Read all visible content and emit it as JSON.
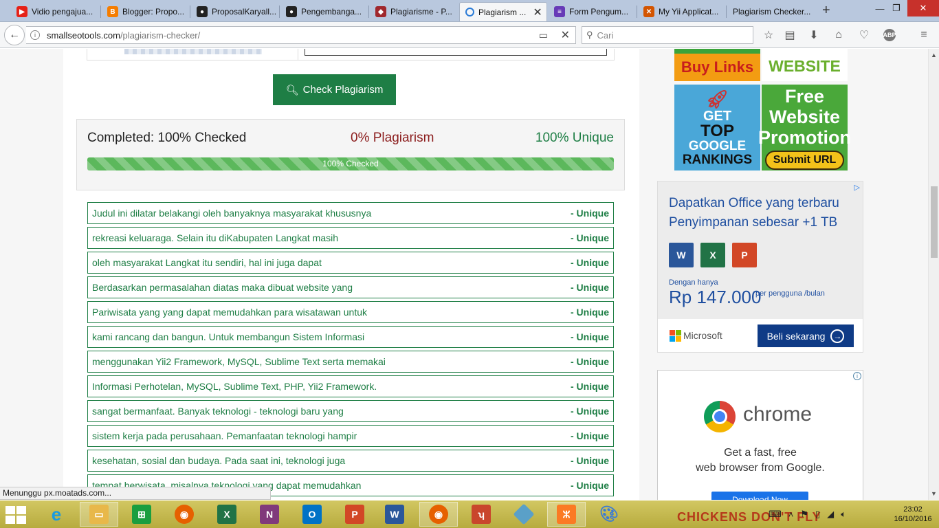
{
  "browser": {
    "tabs": [
      {
        "label": "Vidio pengajua...",
        "favicon": "youtube-icon",
        "color": "#e62117"
      },
      {
        "label": "Blogger: Propo...",
        "favicon": "blogger-icon",
        "color": "#f57d00"
      },
      {
        "label": "ProposalKaryall...",
        "favicon": "github-icon",
        "color": "#222222"
      },
      {
        "label": "Pengembanga...",
        "favicon": "github-icon",
        "color": "#222222"
      },
      {
        "label": "Plagiarisme - P...",
        "favicon": "site-icon",
        "color": "#a0282d"
      },
      {
        "label": "Plagiarism ...",
        "favicon": "loading-icon",
        "color": "#2b7bd6",
        "active": true
      },
      {
        "label": "Form Pengum...",
        "favicon": "forms-icon",
        "color": "#673ab7"
      },
      {
        "label": "My Yii Applicat...",
        "favicon": "yii-icon",
        "color": "#d35400"
      },
      {
        "label": "Plagiarism Checker...",
        "favicon": "",
        "color": ""
      }
    ],
    "url_host": "smallseotools.com",
    "url_path": "/plagiarism-checker/",
    "search_placeholder": "Cari",
    "status_text": "Menunggu px.moatads.com..."
  },
  "checker": {
    "button_label": "Check Plagiarism",
    "completed_label": "Completed: 100% Checked",
    "plagiarism_label": "0% Plagiarism",
    "unique_label": "100% Unique",
    "progress_label": "100% Checked",
    "progress_value": 1.0,
    "results": [
      {
        "text": "Judul ini dilatar belakangi oleh banyaknya masyarakat khususnya",
        "tag": "- Unique"
      },
      {
        "text": "rekreasi keluaraga. Selain itu diKabupaten Langkat masih",
        "tag": "- Unique"
      },
      {
        "text": "oleh masyarakat Langkat itu sendiri, hal ini juga dapat",
        "tag": "- Unique"
      },
      {
        "text": "Berdasarkan permasalahan diatas maka dibuat website yang",
        "tag": "- Unique"
      },
      {
        "text": "Pariwisata yang yang dapat memudahkan para wisatawan untuk",
        "tag": "- Unique"
      },
      {
        "text": "kami rancang dan bangun. Untuk membangun Sistem Informasi",
        "tag": "- Unique"
      },
      {
        "text": "menggunakan Yii2 Framework, MySQL, Sublime Text serta memakai",
        "tag": "- Unique"
      },
      {
        "text": "Informasi Perhotelan, MySQL, Sublime Text, PHP, Yii2 Framework.",
        "tag": "- Unique"
      },
      {
        "text": "sangat bermanfaat. Banyak teknologi - teknologi baru yang",
        "tag": "- Unique"
      },
      {
        "text": "sistem kerja pada perusahaan. Pemanfaatan teknologi hampir",
        "tag": "- Unique"
      },
      {
        "text": "kesehatan, sosial dan budaya. Pada saat ini, teknologi juga",
        "tag": "- Unique"
      },
      {
        "text": "tempat berwisata, misalnya teknologi yang dapat memudahkan",
        "tag": "- Unique"
      }
    ]
  },
  "sidebar": {
    "ad_buylinks": "Buy Links",
    "ad_website": "WEBSITE",
    "ad_rankings": [
      "GET",
      "TOP",
      "GOOGLE",
      "RANKINGS"
    ],
    "ad_promo_title": "Free Website Promotion",
    "ad_promo_cta": "Submit URL",
    "office": {
      "headline": "Dapatkan Office yang terbaru Penyimpanan sebesar +1 TB",
      "price_label": "Dengan hanya",
      "price": "Rp 147.000",
      "per": "per pengguna /bulan",
      "brand": "Microsoft",
      "cta": "Beli sekarang"
    },
    "chrome": {
      "name": "chrome",
      "tagline_1": "Get a fast, free",
      "tagline_2": "web browser from Google.",
      "cta": "Download Now"
    }
  },
  "taskbar": {
    "time": "23:02",
    "date": "16/10/2016",
    "wallpaper_text": "CHICKENS DON'T FLY"
  },
  "colors": {
    "accent_green": "#1e7e45",
    "plagiarism_red": "#8b1c1c",
    "progress_green": "#5cb85c"
  }
}
